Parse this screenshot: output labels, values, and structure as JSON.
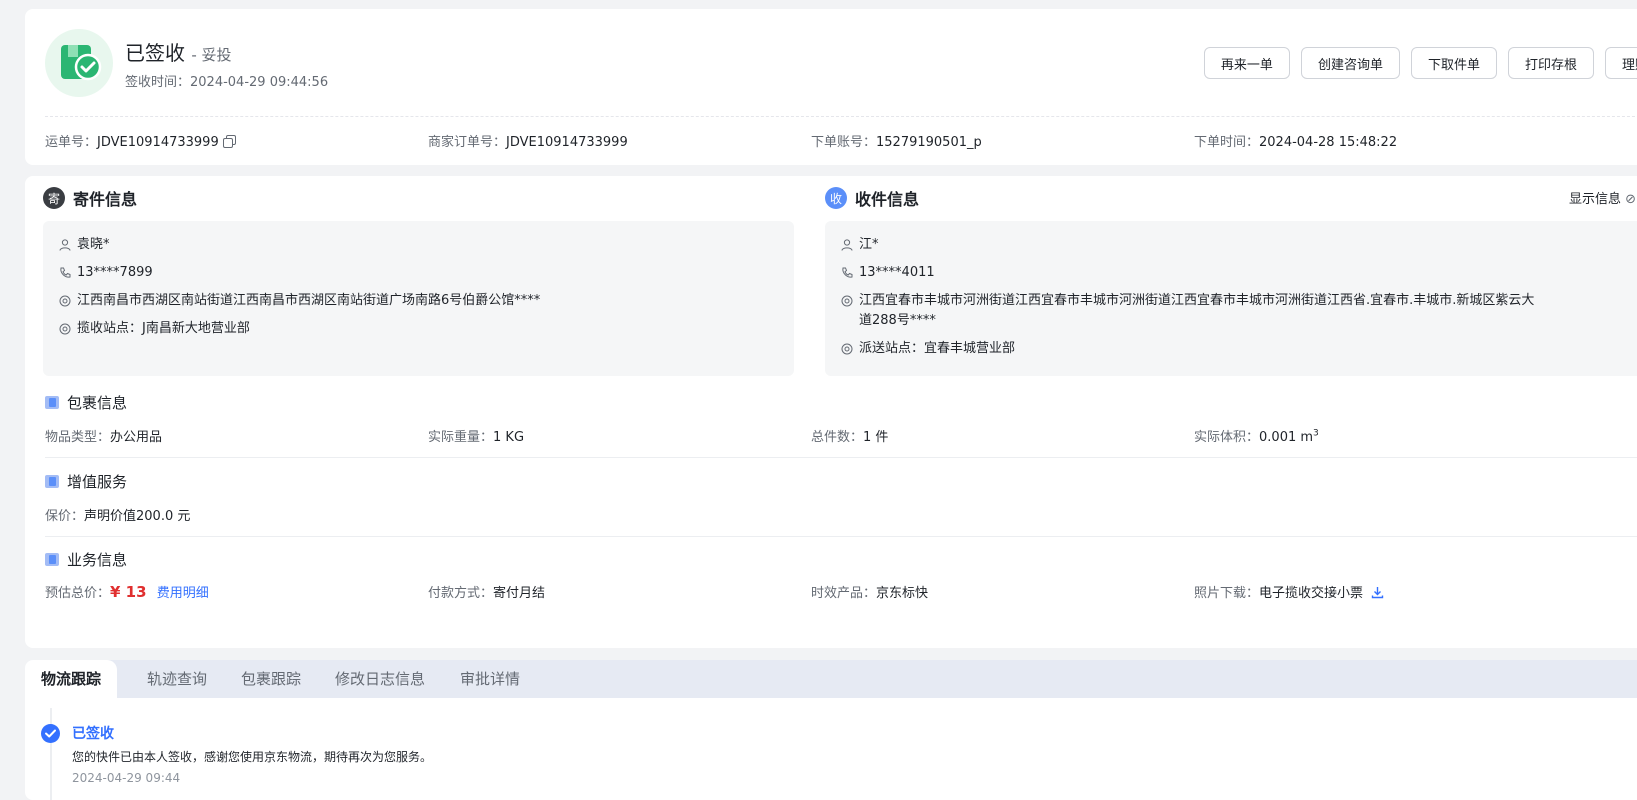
{
  "status": {
    "title": "已签收",
    "subtitle": "- 妥投",
    "sign_time_label": "签收时间：",
    "sign_time": "2024-04-29 09:44:56"
  },
  "actions": [
    "再来一单",
    "创建咨询单",
    "下取件单",
    "打印存根",
    "理赔"
  ],
  "meta": {
    "waybill_label": "运单号：",
    "waybill": "JDVE10914733999",
    "merchant_label": "商家订单号：",
    "merchant": "JDVE10914733999",
    "account_label": "下单账号：",
    "account": "15279190501_p",
    "order_time_label": "下单时间：",
    "order_time": "2024-04-28 15:48:22"
  },
  "sender": {
    "badge": "寄",
    "title": "寄件信息",
    "name": "袁晓*",
    "phone": "13****7899",
    "address": "江西南昌市西湖区南站街道江西南昌市西湖区南站街道广场南路6号伯爵公馆****",
    "station_label": "揽收站点：",
    "station": "J南昌新大地营业部"
  },
  "receiver": {
    "badge": "收",
    "title": "收件信息",
    "show_info": "显示信息",
    "name": "江*",
    "phone": "13****4011",
    "address_line1": "江西宜春市丰城市河洲街道江西宜春市丰城市河洲街道江西宜春市丰城市河洲街道江西省.宜春市.丰城市.新城区紫云大",
    "address_line2": "道288号****",
    "station_label": "派送站点：",
    "station": "宜春丰城营业部"
  },
  "package": {
    "title": "包裹信息",
    "type_label": "物品类型：",
    "type": "办公用品",
    "weight_label": "实际重量：",
    "weight": "1 KG",
    "count_label": "总件数：",
    "count": "1 件",
    "volume_label": "实际体积：",
    "volume": "0.001 m",
    "volume_sup": "3"
  },
  "value_added": {
    "title": "增值服务",
    "insurance_label": "保价：",
    "insurance": "声明价值200.0 元"
  },
  "business": {
    "title": "业务信息",
    "total_label": "预估总价：",
    "total": "¥ 13",
    "fee_link": "费用明细",
    "payment_label": "付款方式：",
    "payment": "寄付月结",
    "product_label": "时效产品：",
    "product": "京东标快",
    "photo_label": "照片下载：",
    "photo": "电子揽收交接小票"
  },
  "tabs": [
    "物流跟踪",
    "轨迹查询",
    "包裹跟踪",
    "修改日志信息",
    "审批详情"
  ],
  "tracking": {
    "title": "已签收",
    "desc": "您的快件已由本人签收，感谢您使用京东物流，期待再次为您服务。",
    "time": "2024-04-29 09:44"
  },
  "colors": {
    "accent": "#3370ff",
    "price": "#e02f2f",
    "success": "#2bb673"
  }
}
